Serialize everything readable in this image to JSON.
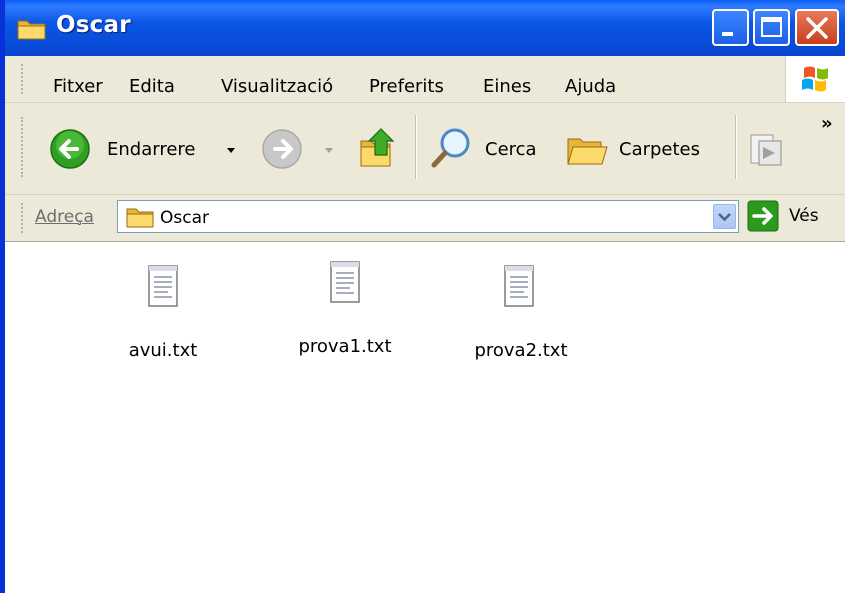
{
  "window": {
    "title": "Oscar"
  },
  "menu": {
    "items": [
      "Fitxer",
      "Edita",
      "Visualització",
      "Preferits",
      "Eines",
      "Ajuda"
    ]
  },
  "toolbar": {
    "back_label": "Endarrere",
    "search_label": "Cerca",
    "folders_label": "Carpetes",
    "overflow": "»"
  },
  "address": {
    "label": "Adreça",
    "value": "Oscar",
    "go_label": "Vés"
  },
  "files": [
    {
      "name": "avui.txt",
      "icon": "text-file-icon"
    },
    {
      "name": "prova1.txt",
      "icon": "text-file-icon"
    },
    {
      "name": "prova2.txt",
      "icon": "text-file-icon"
    }
  ],
  "colors": {
    "titlebar": "#0a4edb",
    "chrome": "#ece9d8",
    "close": "#c7401c"
  }
}
